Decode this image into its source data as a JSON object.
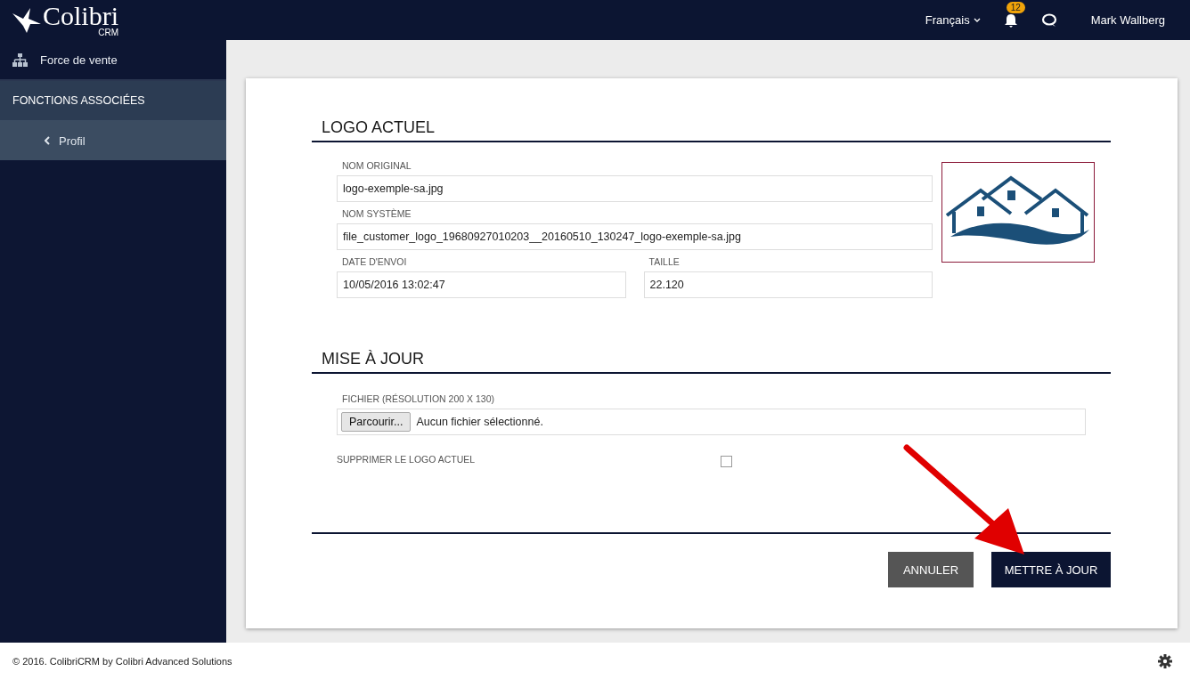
{
  "header": {
    "brand": "Colibri",
    "brand_sub": "CRM",
    "language": "Français",
    "notification_count": "12",
    "user": "Mark Wallberg"
  },
  "sidebar": {
    "items": [
      {
        "label": "Force de vente",
        "kind": "nav"
      },
      {
        "label": "FONCTIONS ASSOCIÉES",
        "kind": "heading"
      },
      {
        "label": "Profil",
        "kind": "back"
      }
    ]
  },
  "current_logo": {
    "title": "LOGO ACTUEL",
    "rows": [
      [
        {
          "label": "NOM ORIGINAL",
          "value": "logo-exemple-sa.jpg"
        }
      ],
      [
        {
          "label": "NOM SYSTÈME",
          "value": "file_customer_logo_19680927010203__20160510_130247_logo-exemple-sa.jpg"
        }
      ],
      [
        {
          "label": "DATE D'ENVOI",
          "value": "10/05/2016 13:02:47"
        },
        {
          "label": "TAILLE",
          "value": "22.120"
        }
      ]
    ]
  },
  "update": {
    "title": "MISE À JOUR",
    "file_label": "FICHIER (RÉSOLUTION 200 X 130)",
    "browse_button": "Parcourir...",
    "file_status": "Aucun fichier sélectionné.",
    "delete_label": "SUPPRIMER LE LOGO ACTUEL",
    "delete_checked": false
  },
  "actions": [
    {
      "label": "ANNULER",
      "kind": "secondary"
    },
    {
      "label": "METTRE À JOUR",
      "kind": "primary"
    }
  ],
  "footer": {
    "text": "© 2016. ColibriCRM by Colibri Advanced Solutions"
  }
}
